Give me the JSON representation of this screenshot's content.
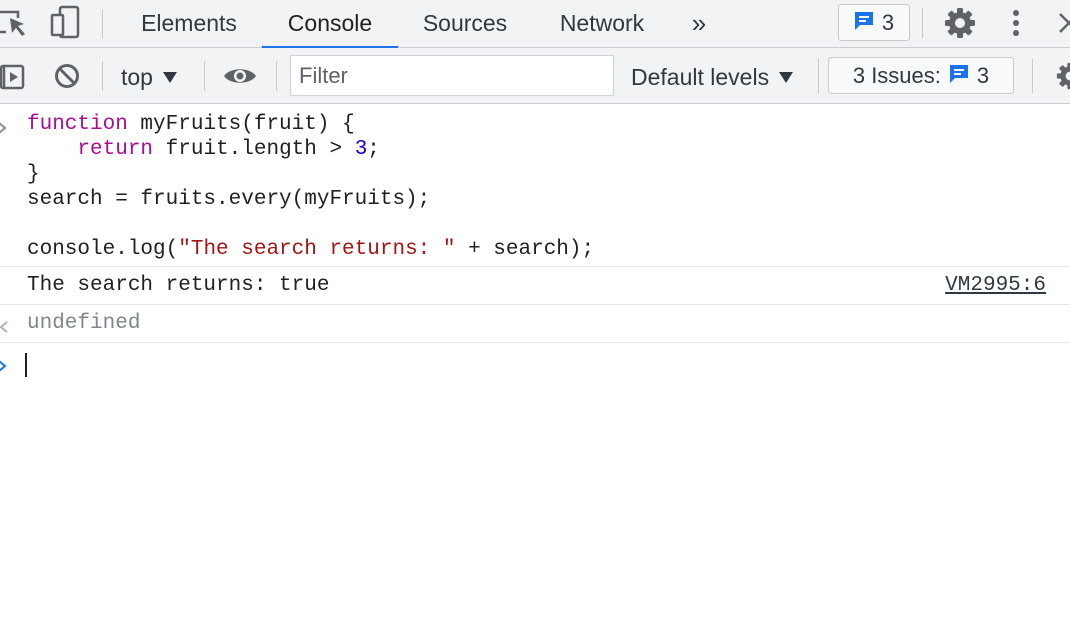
{
  "tabs": [
    {
      "label": "Elements"
    },
    {
      "label": "Console"
    },
    {
      "label": "Sources"
    },
    {
      "label": "Network"
    }
  ],
  "header": {
    "more_tabs_glyph": "»",
    "messages_count": "3"
  },
  "toolbar": {
    "context": "top",
    "filter_placeholder": "Filter",
    "levels": "Default levels",
    "issues_label": "3 Issues:",
    "issues_count": "3"
  },
  "console": {
    "input_lines": [
      {
        "segments": [
          {
            "t": "function",
            "c": "kw"
          },
          {
            "t": " myFruits(fruit) {",
            "c": ""
          }
        ]
      },
      {
        "segments": [
          {
            "t": "    ",
            "c": ""
          },
          {
            "t": "return",
            "c": "kw"
          },
          {
            "t": " fruit.length > ",
            "c": ""
          },
          {
            "t": "3",
            "c": "num"
          },
          {
            "t": ";",
            "c": ""
          }
        ]
      },
      {
        "segments": [
          {
            "t": "}",
            "c": ""
          }
        ]
      },
      {
        "segments": [
          {
            "t": "search = fruits.every(myFruits);",
            "c": ""
          }
        ]
      },
      {
        "segments": [
          {
            "t": "",
            "c": ""
          }
        ]
      },
      {
        "segments": [
          {
            "t": "console.log(",
            "c": ""
          },
          {
            "t": "\"The search returns: \"",
            "c": "str"
          },
          {
            "t": " + search);",
            "c": ""
          }
        ]
      }
    ],
    "log_output": "The search returns: true",
    "log_source": "VM2995:6",
    "return_value": "undefined"
  },
  "colors": {
    "accent": "#1a73e8",
    "keyword": "#aa0d91",
    "number": "#1c00cf",
    "string": "#a31515"
  },
  "icons": [
    "inspect-element-icon",
    "device-toolbar-icon",
    "chevron-double-right-icon",
    "message-icon",
    "gear-icon",
    "kebab-menu-icon",
    "close-icon",
    "sidebar-toggle-icon",
    "clear-console-icon",
    "eye-icon",
    "dropdown-triangle-icon",
    "console-prompt-icon",
    "return-arrow-icon"
  ]
}
